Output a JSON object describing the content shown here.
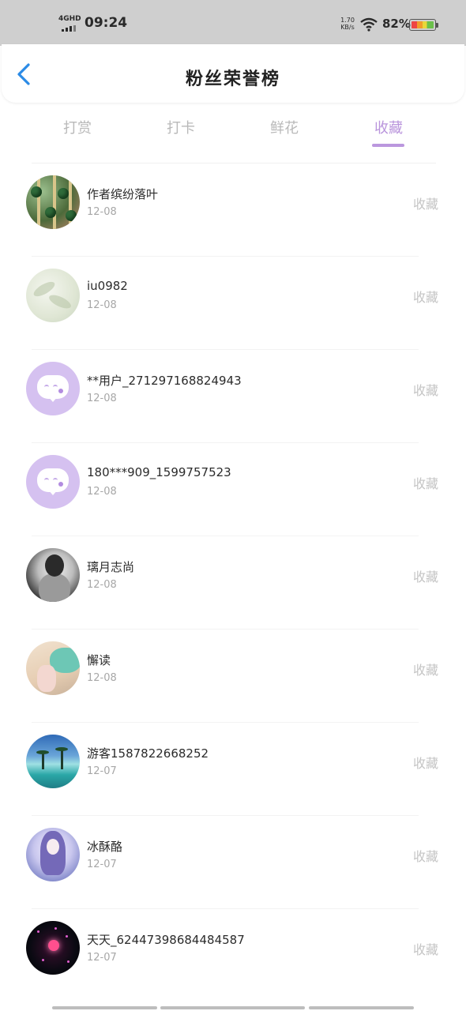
{
  "status_bar": {
    "network": "4GHD",
    "time": "09:24",
    "net_speed_value": "1.70",
    "net_speed_unit": "KB/s",
    "battery_percent": "82%"
  },
  "header": {
    "title": "粉丝荣誉榜"
  },
  "tabs": [
    {
      "label": "打赏",
      "active": false
    },
    {
      "label": "打卡",
      "active": false
    },
    {
      "label": "鲜花",
      "active": false
    },
    {
      "label": "收藏",
      "active": true
    }
  ],
  "colors": {
    "accent": "#b994dc",
    "inactive_tab": "#b9b9b9",
    "action_text": "#c4c4c4"
  },
  "list": [
    {
      "name": "作者缤纷落叶",
      "date": "12-08",
      "action": "收藏"
    },
    {
      "name": "iu0982",
      "date": "12-08",
      "action": "收藏"
    },
    {
      "name": "**用户_271297168824943",
      "date": "12-08",
      "action": "收藏"
    },
    {
      "name": "180***909_1599757523",
      "date": "12-08",
      "action": "收藏"
    },
    {
      "name": "璃月志尚",
      "date": "12-08",
      "action": "收藏"
    },
    {
      "name": "懈读",
      "date": "12-08",
      "action": "收藏"
    },
    {
      "name": "游客1587822668252",
      "date": "12-07",
      "action": "收藏"
    },
    {
      "name": "冰酥酪",
      "date": "12-07",
      "action": "收藏"
    },
    {
      "name": "天天_62447398684484587",
      "date": "12-07",
      "action": "收藏"
    }
  ]
}
